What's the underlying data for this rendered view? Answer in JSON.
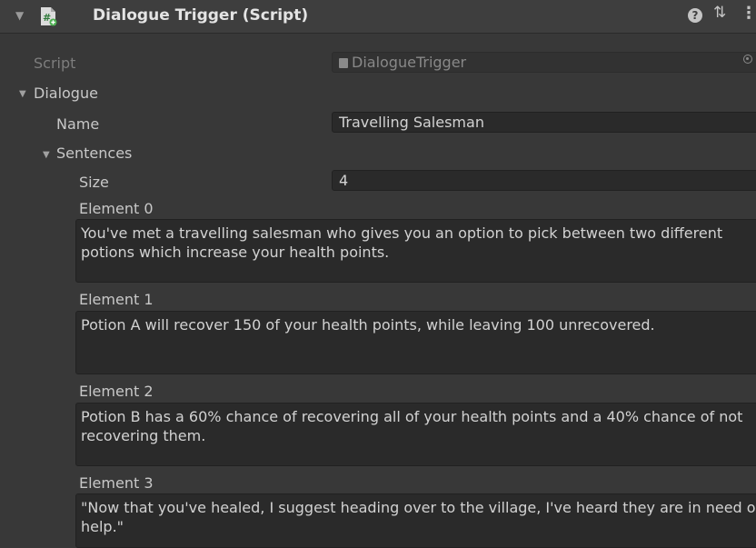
{
  "header": {
    "title": "Dialogue Trigger (Script)",
    "foldout_icon": "triangle-down-icon",
    "component_icon": "csharp-script-icon",
    "help_icon": "help-icon",
    "preset_icon": "preset-sliders-icon",
    "menu_icon": "kebab-menu-icon"
  },
  "script": {
    "label": "Script",
    "value": "DialogueTrigger"
  },
  "dialogue": {
    "label": "Dialogue",
    "name_label": "Name",
    "name_value": "Travelling Salesman",
    "sentences_label": "Sentences",
    "size_label": "Size",
    "size_value": "4",
    "elements": [
      {
        "label": "Element 0",
        "text": "You've met a travelling salesman who gives you an option to pick between two different potions which increase your health points."
      },
      {
        "label": "Element 1",
        "text": "Potion A will recover 150 of your health points, while leaving 100 unrecovered."
      },
      {
        "label": "Element 2",
        "text": "Potion B has a 60% chance of recovering all of your health points and a 40% chance of not recovering them."
      },
      {
        "label": "Element 3",
        "text": "\"Now that you've healed, I suggest heading over to the village, I've heard they are in need of help.\""
      }
    ]
  },
  "colors": {
    "background": "#383838",
    "header": "#3e3e3e",
    "field": "#2a2a2a",
    "text": "#c8c8c8"
  }
}
